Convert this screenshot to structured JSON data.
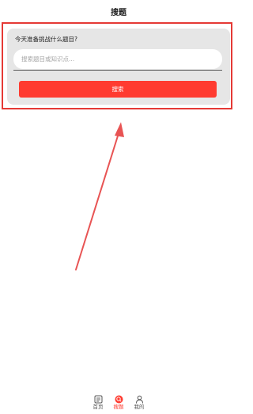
{
  "header": {
    "title": "搜题"
  },
  "search": {
    "prompt": "今天准备挑战什么题目?",
    "placeholder": "搜索题目或知识点...",
    "button_label": "搜索"
  },
  "tabbar": {
    "items": [
      {
        "label": "首页",
        "icon": "home-icon",
        "active": false
      },
      {
        "label": "搜题",
        "icon": "search-target-icon",
        "active": true
      },
      {
        "label": "我的",
        "icon": "user-icon",
        "active": false
      }
    ]
  },
  "colors": {
    "accent": "#ff3b30",
    "highlight": "#e53935",
    "card_bg": "#e6e6e6"
  }
}
